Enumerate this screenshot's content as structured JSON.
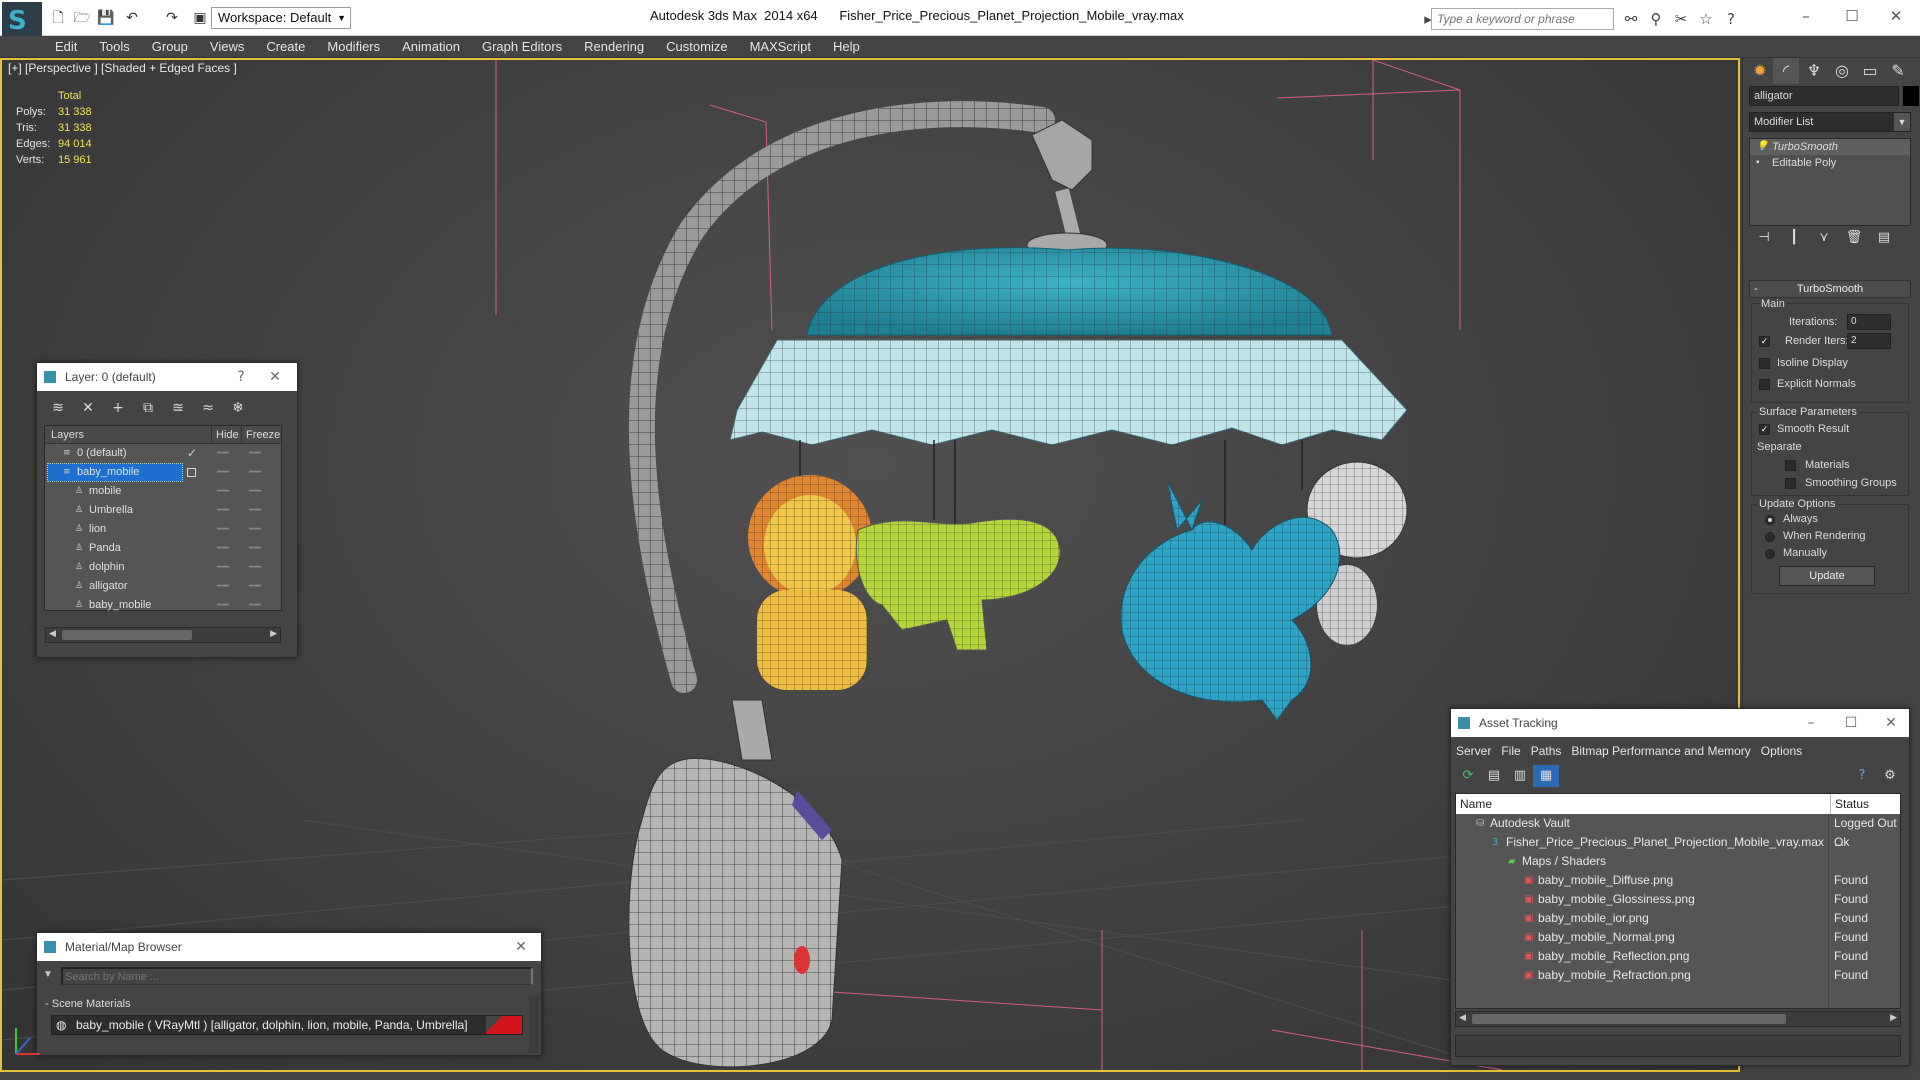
{
  "titlebar": {
    "app_title": "Autodesk 3ds Max  2014 x64",
    "file_title": "Fisher_Price_Precious_Planet_Projection_Mobile_vray.max",
    "workspace": "Workspace: Default",
    "search_placeholder": "Type a keyword or phrase"
  },
  "menu": [
    "Edit",
    "Tools",
    "Group",
    "Views",
    "Create",
    "Modifiers",
    "Animation",
    "Graph Editors",
    "Rendering",
    "Customize",
    "MAXScript",
    "Help"
  ],
  "viewport": {
    "label": "[+] [Perspective ] [Shaded + Edged Faces ]",
    "stats": {
      "total_label": "Total",
      "rows": [
        {
          "label": "Polys:",
          "value": "31 338"
        },
        {
          "label": "Tris:",
          "value": "31 338"
        },
        {
          "label": "Edges:",
          "value": "94 014"
        },
        {
          "label": "Verts:",
          "value": "15 961"
        }
      ]
    }
  },
  "command_panel": {
    "object_name": "alligator",
    "modifier_list": "Modifier List",
    "stack": [
      "TurboSmooth",
      "Editable Poly"
    ],
    "rollout_title": "TurboSmooth",
    "main_label": "Main",
    "iterations_label": "Iterations:",
    "iterations_value": "0",
    "render_iters_label": "Render Iters:",
    "render_iters_value": "2",
    "isoline": "Isoline Display",
    "explicit": "Explicit Normals",
    "surface_params": "Surface Parameters",
    "smooth_result": "Smooth Result",
    "separate": "Separate",
    "materials": "Materials",
    "smoothing_groups": "Smoothing Groups",
    "update_options": "Update Options",
    "always": "Always",
    "when_rendering": "When Rendering",
    "manually": "Manually",
    "update_button": "Update"
  },
  "layer_panel": {
    "title": "Layer: 0 (default)",
    "help": "?",
    "columns": {
      "layers": "Layers",
      "hide": "Hide",
      "freeze": "Freeze"
    },
    "rows": [
      {
        "name": "0 (default)",
        "level": 0
      },
      {
        "name": "baby_mobile",
        "level": 0,
        "selected": true
      },
      {
        "name": "mobile",
        "level": 1
      },
      {
        "name": "Umbrella",
        "level": 1
      },
      {
        "name": "lion",
        "level": 1
      },
      {
        "name": "Panda",
        "level": 1
      },
      {
        "name": "dolphin",
        "level": 1
      },
      {
        "name": "alligator",
        "level": 1
      },
      {
        "name": "baby_mobile",
        "level": 1
      }
    ]
  },
  "asset_panel": {
    "title": "Asset Tracking",
    "menu": [
      "Server",
      "File",
      "Paths",
      "Bitmap Performance and Memory",
      "Options"
    ],
    "columns": {
      "name": "Name",
      "status": "Status"
    },
    "rows": [
      {
        "name": "Autodesk Vault",
        "status": "Logged Out ...",
        "indent": 0,
        "icon": "vault-icon"
      },
      {
        "name": "Fisher_Price_Precious_Planet_Projection_Mobile_vray.max",
        "status": "Ok",
        "indent": 1,
        "icon": "max-file-icon"
      },
      {
        "name": "Maps / Shaders",
        "status": "",
        "indent": 2,
        "icon": "maps-folder-icon"
      },
      {
        "name": "baby_mobile_Diffuse.png",
        "status": "Found",
        "indent": 3,
        "icon": "png-file-icon"
      },
      {
        "name": "baby_mobile_Glossiness.png",
        "status": "Found",
        "indent": 3,
        "icon": "png-file-icon"
      },
      {
        "name": "baby_mobile_ior.png",
        "status": "Found",
        "indent": 3,
        "icon": "png-file-icon"
      },
      {
        "name": "baby_mobile_Normal.png",
        "status": "Found",
        "indent": 3,
        "icon": "png-file-icon"
      },
      {
        "name": "baby_mobile_Reflection.png",
        "status": "Found",
        "indent": 3,
        "icon": "png-file-icon"
      },
      {
        "name": "baby_mobile_Refraction.png",
        "status": "Found",
        "indent": 3,
        "icon": "png-file-icon"
      }
    ]
  },
  "material_panel": {
    "title": "Material/Map Browser",
    "search_placeholder": "Search by Name ...",
    "group": "Scene Materials",
    "item": "baby_mobile  ( VRayMtl )  [alligator, dolphin, lion, mobile, Panda, Umbrella]"
  },
  "colors": {
    "viewport_border": "#e8c13c",
    "stats_value": "#f1e24c",
    "selection": "#1e6fcf",
    "umbrella_top": "#2f9bb0",
    "umbrella_ruffle": "#bfe4ec",
    "lion": "#f2b63a",
    "alligator": "#b4d637",
    "dolphin": "#2aa5c9",
    "panda": "#d6d6d6"
  }
}
